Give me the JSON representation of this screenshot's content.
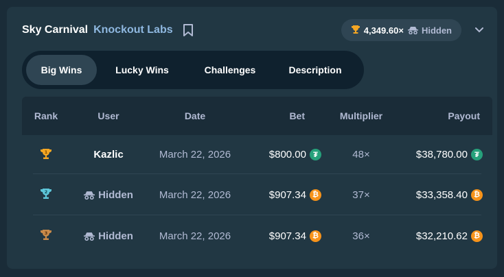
{
  "header": {
    "game_title": "Sky Carnival",
    "provider": "Knockout Labs",
    "record_multiplier": "4,349.60×",
    "record_user": "Hidden"
  },
  "tabs": [
    {
      "label": "Big Wins",
      "active": true
    },
    {
      "label": "Lucky Wins",
      "active": false
    },
    {
      "label": "Challenges",
      "active": false
    },
    {
      "label": "Description",
      "active": false
    }
  ],
  "table": {
    "columns": [
      "Rank",
      "User",
      "Date",
      "Bet",
      "Multiplier",
      "Payout"
    ],
    "rows": [
      {
        "rank_icon": "trophy-gold-icon",
        "rank": "1",
        "user": "Kazlic",
        "hidden": false,
        "date": "March 22, 2026",
        "bet": "$800.00",
        "bet_currency": "usdt-icon",
        "multiplier": "48×",
        "payout": "$38,780.00",
        "payout_currency": "usdt-icon"
      },
      {
        "rank_icon": "trophy-silver-icon",
        "rank": "2",
        "user": "Hidden",
        "hidden": true,
        "date": "March 22, 2026",
        "bet": "$907.34",
        "bet_currency": "btc-icon",
        "multiplier": "37×",
        "payout": "$33,358.40",
        "payout_currency": "btc-icon"
      },
      {
        "rank_icon": "trophy-bronze-icon",
        "rank": "3",
        "user": "Hidden",
        "hidden": true,
        "date": "March 22, 2026",
        "bet": "$907.34",
        "bet_currency": "btc-icon",
        "multiplier": "36×",
        "payout": "$32,210.62",
        "payout_currency": "btc-icon"
      }
    ]
  },
  "colors": {
    "gold": "#f5a623",
    "silver": "#5ec6d9",
    "bronze": "#c98a4a",
    "usdt": "#26a17b",
    "btc": "#f7931a"
  }
}
